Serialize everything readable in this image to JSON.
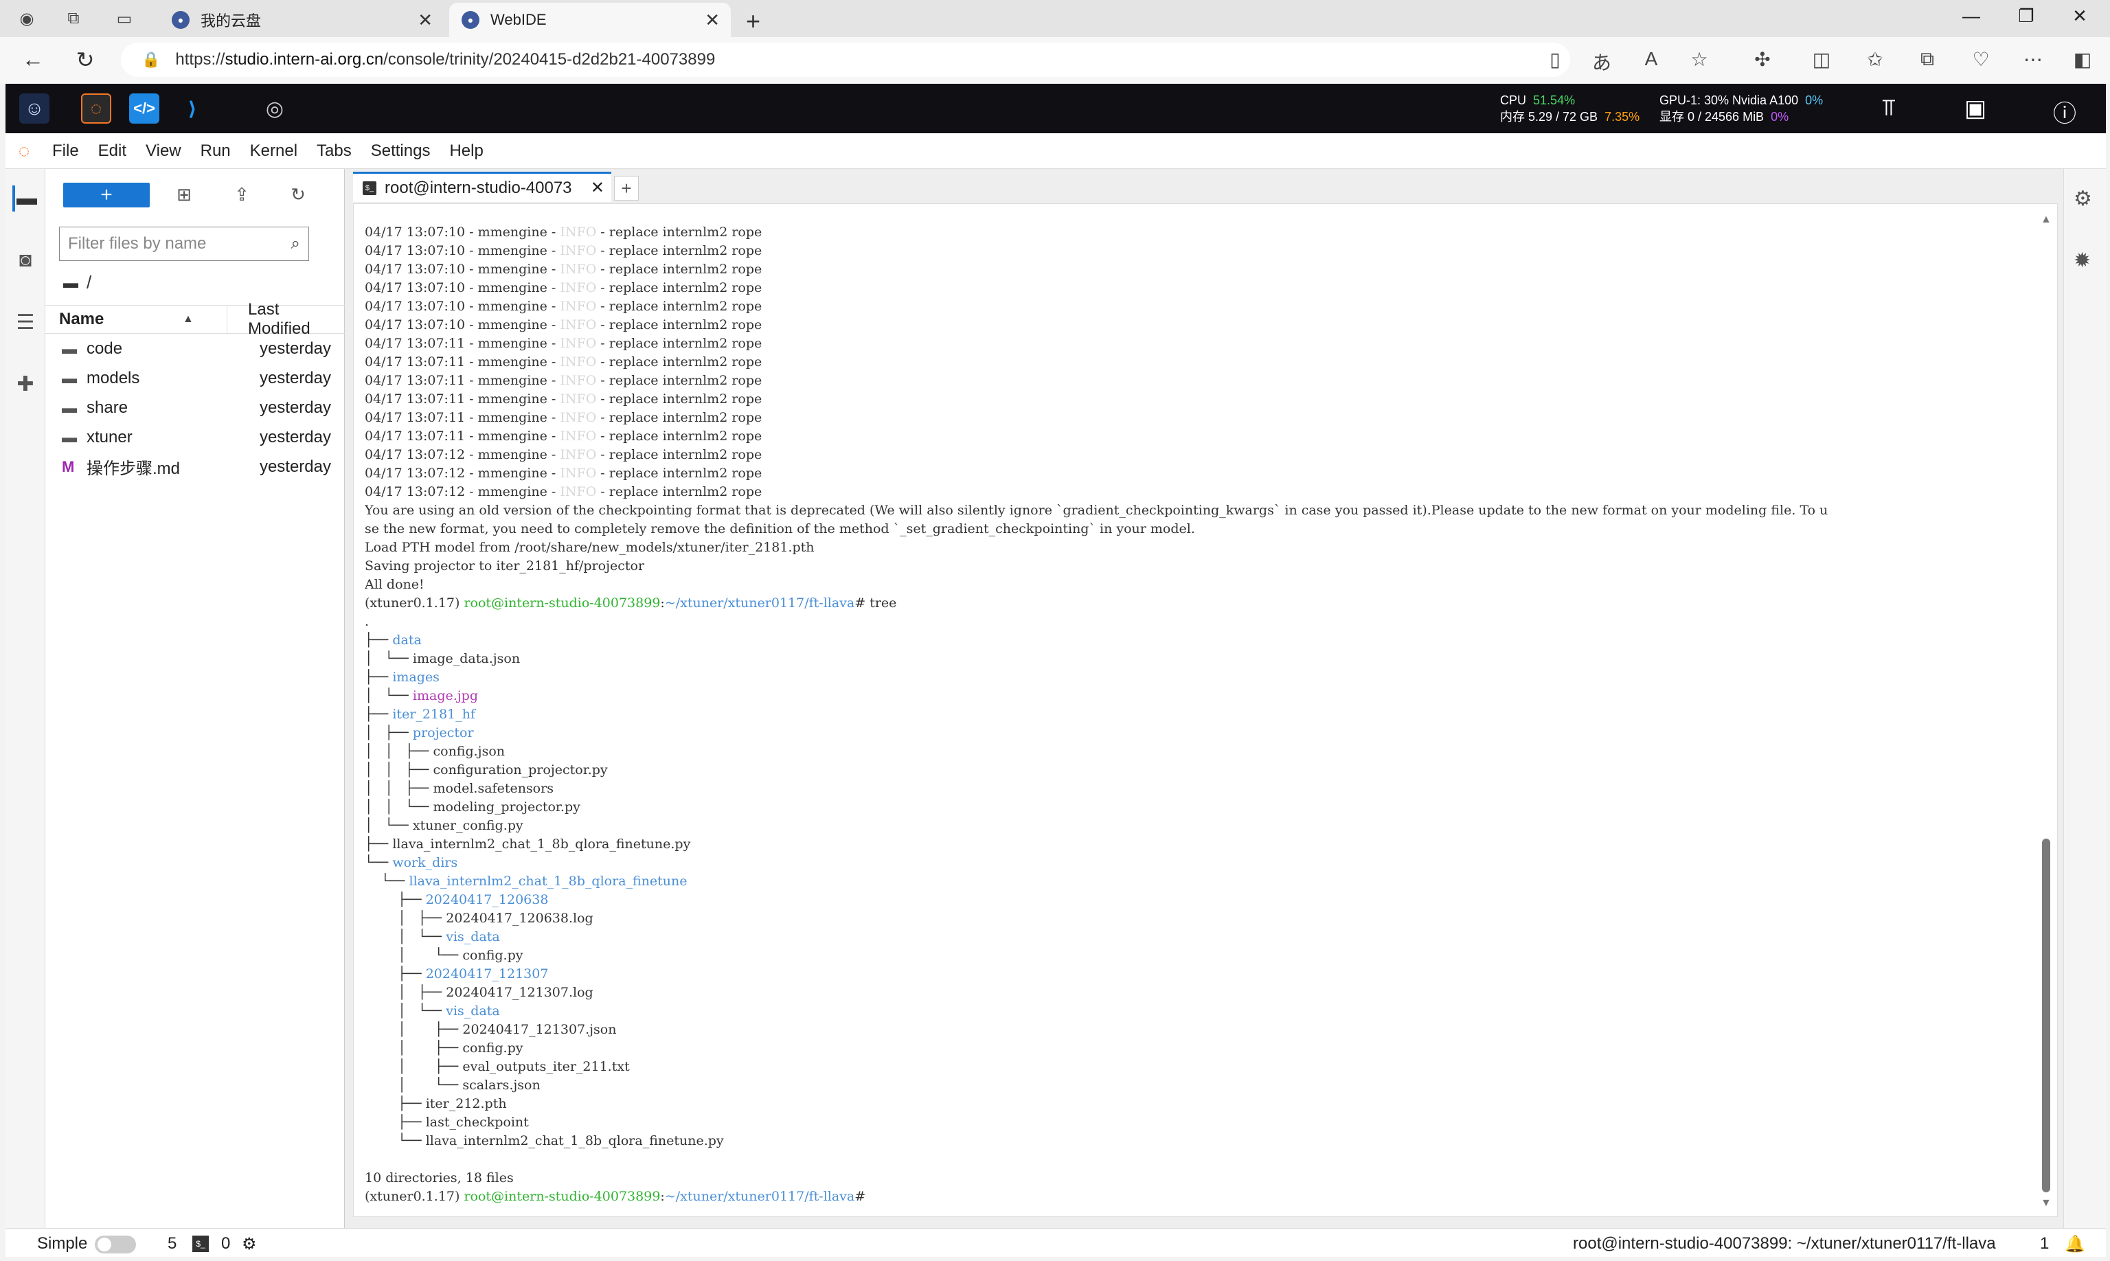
{
  "browser": {
    "tabs": [
      {
        "title": "我的云盘",
        "active": false
      },
      {
        "title": "WebIDE",
        "active": true
      }
    ],
    "url_prefix": "https://",
    "url_domain": "studio.intern-ai.org.cn",
    "url_path": "/console/trinity/20240415-d2d2b21-40073899"
  },
  "resources": {
    "cpu_label": "CPU",
    "cpu_value": "51.54%",
    "mem_label": "内存 5.29 / 72 GB",
    "mem_value": "7.35%",
    "gpu_label": "GPU-1: 30% Nvidia A100",
    "gpu_value": "0%",
    "vram_label": "显存 0 / 24566 MiB",
    "vram_value": "0%"
  },
  "menu": [
    "File",
    "Edit",
    "View",
    "Run",
    "Kernel",
    "Tabs",
    "Settings",
    "Help"
  ],
  "filebrowser": {
    "new_label": "+",
    "filter_placeholder": "Filter files by name",
    "breadcrumb": "/",
    "col_name": "Name",
    "col_modified": "Last Modified",
    "files": [
      {
        "name": "code",
        "modified": "yesterday",
        "type": "folder"
      },
      {
        "name": "models",
        "modified": "yesterday",
        "type": "folder"
      },
      {
        "name": "share",
        "modified": "yesterday",
        "type": "folder"
      },
      {
        "name": "xtuner",
        "modified": "yesterday",
        "type": "folder"
      },
      {
        "name": "操作步骤.md",
        "modified": "yesterday",
        "type": "markdown"
      }
    ]
  },
  "terminal": {
    "tab_title": "root@intern-studio-40073",
    "log_lines": [
      {
        "time": "04/17 13:07:10",
        "src": "mmengine",
        "level": "INFO",
        "msg": "replace internlm2 rope"
      },
      {
        "time": "04/17 13:07:10",
        "src": "mmengine",
        "level": "INFO",
        "msg": "replace internlm2 rope"
      },
      {
        "time": "04/17 13:07:10",
        "src": "mmengine",
        "level": "INFO",
        "msg": "replace internlm2 rope"
      },
      {
        "time": "04/17 13:07:10",
        "src": "mmengine",
        "level": "INFO",
        "msg": "replace internlm2 rope"
      },
      {
        "time": "04/17 13:07:10",
        "src": "mmengine",
        "level": "INFO",
        "msg": "replace internlm2 rope"
      },
      {
        "time": "04/17 13:07:10",
        "src": "mmengine",
        "level": "INFO",
        "msg": "replace internlm2 rope"
      },
      {
        "time": "04/17 13:07:11",
        "src": "mmengine",
        "level": "INFO",
        "msg": "replace internlm2 rope"
      },
      {
        "time": "04/17 13:07:11",
        "src": "mmengine",
        "level": "INFO",
        "msg": "replace internlm2 rope"
      },
      {
        "time": "04/17 13:07:11",
        "src": "mmengine",
        "level": "INFO",
        "msg": "replace internlm2 rope"
      },
      {
        "time": "04/17 13:07:11",
        "src": "mmengine",
        "level": "INFO",
        "msg": "replace internlm2 rope"
      },
      {
        "time": "04/17 13:07:11",
        "src": "mmengine",
        "level": "INFO",
        "msg": "replace internlm2 rope"
      },
      {
        "time": "04/17 13:07:11",
        "src": "mmengine",
        "level": "INFO",
        "msg": "replace internlm2 rope"
      },
      {
        "time": "04/17 13:07:12",
        "src": "mmengine",
        "level": "INFO",
        "msg": "replace internlm2 rope"
      },
      {
        "time": "04/17 13:07:12",
        "src": "mmengine",
        "level": "INFO",
        "msg": "replace internlm2 rope"
      },
      {
        "time": "04/17 13:07:12",
        "src": "mmengine",
        "level": "INFO",
        "msg": "replace internlm2 rope"
      }
    ],
    "warning_1": "You are using an old version of the checkpointing format that is deprecated (We will also silently ignore `gradient_checkpointing_kwargs` in case you passed it).Please update to the new format on your modeling file. To u",
    "warning_2": "se the new format, you need to completely remove the definition of the method `_set_gradient_checkpointing` in your model.",
    "load_line": "Load PTH model from /root/share/new_models/xtuner/iter_2181.pth",
    "saving_line": "Saving projector to iter_2181_hf/projector",
    "done_line": "All done!",
    "prompt_env": "(xtuner0.1.17)",
    "prompt_user": "root@intern-studio-40073899",
    "prompt_path": "~/xtuner/xtuner0117/ft-llava",
    "command": "tree",
    "tree_root": ".",
    "tree": [
      {
        "prefix": "├── ",
        "name": "data",
        "kind": "dir"
      },
      {
        "prefix": "│   └── ",
        "name": "image_data.json",
        "kind": "file"
      },
      {
        "prefix": "├── ",
        "name": "images",
        "kind": "dir"
      },
      {
        "prefix": "│   └── ",
        "name": "image.jpg",
        "kind": "image"
      },
      {
        "prefix": "├── ",
        "name": "iter_2181_hf",
        "kind": "dir"
      },
      {
        "prefix": "│   ├── ",
        "name": "projector",
        "kind": "dir"
      },
      {
        "prefix": "│   │   ├── ",
        "name": "config.json",
        "kind": "file"
      },
      {
        "prefix": "│   │   ├── ",
        "name": "configuration_projector.py",
        "kind": "file"
      },
      {
        "prefix": "│   │   ├── ",
        "name": "model.safetensors",
        "kind": "file"
      },
      {
        "prefix": "│   │   └── ",
        "name": "modeling_projector.py",
        "kind": "file"
      },
      {
        "prefix": "│   └── ",
        "name": "xtuner_config.py",
        "kind": "file"
      },
      {
        "prefix": "├── ",
        "name": "llava_internlm2_chat_1_8b_qlora_finetune.py",
        "kind": "file"
      },
      {
        "prefix": "└── ",
        "name": "work_dirs",
        "kind": "dir"
      },
      {
        "prefix": "    └── ",
        "name": "llava_internlm2_chat_1_8b_qlora_finetune",
        "kind": "dir"
      },
      {
        "prefix": "        ├── ",
        "name": "20240417_120638",
        "kind": "dir"
      },
      {
        "prefix": "        │   ├── ",
        "name": "20240417_120638.log",
        "kind": "file"
      },
      {
        "prefix": "        │   └── ",
        "name": "vis_data",
        "kind": "dir"
      },
      {
        "prefix": "        │       └── ",
        "name": "config.py",
        "kind": "file"
      },
      {
        "prefix": "        ├── ",
        "name": "20240417_121307",
        "kind": "dir"
      },
      {
        "prefix": "        │   ├── ",
        "name": "20240417_121307.log",
        "kind": "file"
      },
      {
        "prefix": "        │   └── ",
        "name": "vis_data",
        "kind": "dir"
      },
      {
        "prefix": "        │       ├── ",
        "name": "20240417_121307.json",
        "kind": "file"
      },
      {
        "prefix": "        │       ├── ",
        "name": "config.py",
        "kind": "file"
      },
      {
        "prefix": "        │       ├── ",
        "name": "eval_outputs_iter_211.txt",
        "kind": "file"
      },
      {
        "prefix": "        │       └── ",
        "name": "scalars.json",
        "kind": "file"
      },
      {
        "prefix": "        ├── ",
        "name": "iter_212.pth",
        "kind": "file"
      },
      {
        "prefix": "        ├── ",
        "name": "last_checkpoint",
        "kind": "file"
      },
      {
        "prefix": "        └── ",
        "name": "llava_internlm2_chat_1_8b_qlora_finetune.py",
        "kind": "file"
      }
    ],
    "summary": "10 directories, 18 files"
  },
  "statusbar": {
    "mode_label": "Simple",
    "terminals_count": "5",
    "kernels_count": "0",
    "path": "root@intern-studio-40073899: ~/xtuner/xtuner0117/ft-llava",
    "notifications": "1"
  },
  "colors": {
    "accent": "#1976d2",
    "prompt_user": "#2fb32f",
    "dir": "#4a8fd6",
    "image_file": "#b13db1"
  }
}
